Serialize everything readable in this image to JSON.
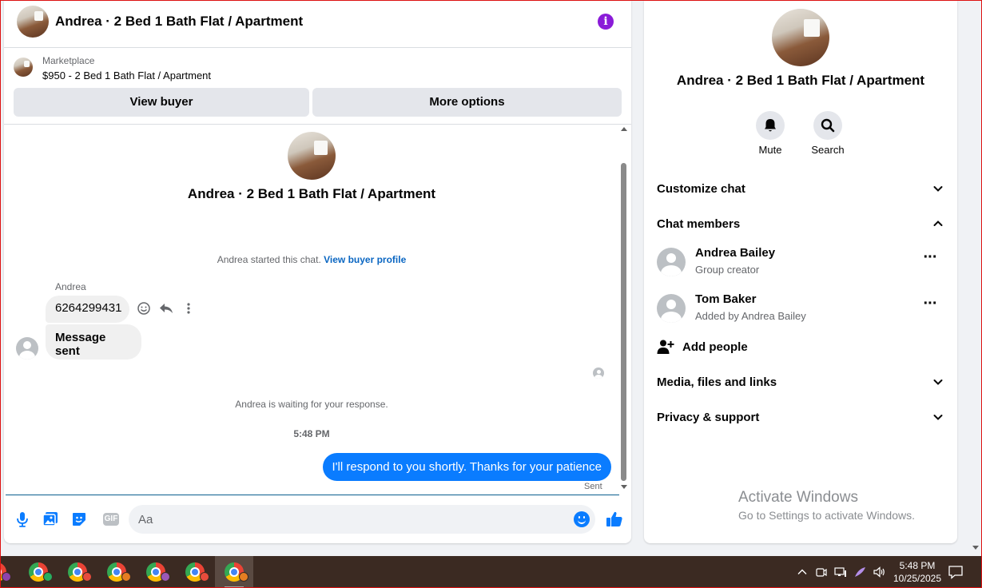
{
  "header": {
    "title": "Andrea · 2 Bed 1 Bath Flat / Apartment"
  },
  "listing": {
    "source": "Marketplace",
    "title": "$950 - 2 Bed 1 Bath Flat / Apartment",
    "view_buyer_label": "View buyer",
    "more_options_label": "More options"
  },
  "conversation": {
    "intro_title": "Andrea · 2 Bed 1 Bath Flat / Apartment",
    "started_text": "Andrea started this chat.",
    "view_profile_link": "View buyer profile",
    "sender_name": "Andrea",
    "incoming": [
      {
        "text": "6264299431"
      },
      {
        "text": "Message sent"
      }
    ],
    "waiting_text": "Andrea is waiting for your response.",
    "timestamp": "5:48 PM",
    "outgoing": {
      "text": "I'll respond to you shortly. Thanks for your patience",
      "status": "Sent"
    }
  },
  "composer": {
    "placeholder": "Aa",
    "gif_label": "GIF"
  },
  "details": {
    "title": "Andrea · 2 Bed 1 Bath Flat / Apartment",
    "mute_label": "Mute",
    "search_label": "Search",
    "sections": {
      "customize": "Customize chat",
      "members": "Chat members",
      "media": "Media, files and links",
      "privacy": "Privacy & support"
    },
    "members": [
      {
        "name": "Andrea Bailey",
        "role": "Group creator"
      },
      {
        "name": "Tom Baker",
        "role": "Added by Andrea Bailey"
      }
    ],
    "add_people_label": "Add people"
  },
  "watermark": {
    "line1": "Activate Windows",
    "line2": "Go to Settings to activate Windows."
  },
  "taskbar": {
    "time": "5:48 PM",
    "date": "10/25/2025",
    "profile_colors": [
      "#8e44ad",
      "#27ae60",
      "#e74c3c",
      "#e67e22",
      "#9b59b6",
      "#e74c3c",
      "#e67e22"
    ]
  },
  "colors": {
    "accent": "#0a7cff",
    "info_purple": "#8a1bd8",
    "link_blue": "#0a66c2"
  }
}
